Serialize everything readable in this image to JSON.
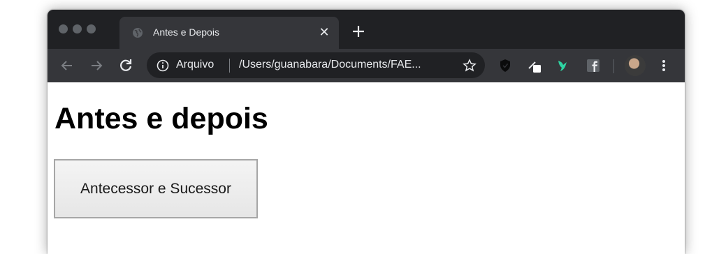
{
  "browser": {
    "tab": {
      "title": "Antes e Depois",
      "close_glyph": "✕"
    },
    "address_bar": {
      "security_label": "Arquivo",
      "url": "/Users/guanabara/Documents/FAE..."
    },
    "icons": [
      "globe-icon",
      "back-arrow-icon",
      "forward-arrow-icon",
      "reload-icon",
      "info-icon",
      "star-icon",
      "shield-extension-icon",
      "pen-extension-icon",
      "bird-extension-icon",
      "facebook-extension-icon",
      "avatar",
      "kebab-menu-icon",
      "new-tab-plus-icon"
    ]
  },
  "page": {
    "heading": "Antes e depois",
    "button_label": "Antecessor e Sucessor"
  },
  "colors": {
    "tabstrip": "#202124",
    "toolbar": "#35363a",
    "omnibox": "#202124",
    "text_light": "#e8eaed",
    "ext_green": "#2ed3a2"
  }
}
